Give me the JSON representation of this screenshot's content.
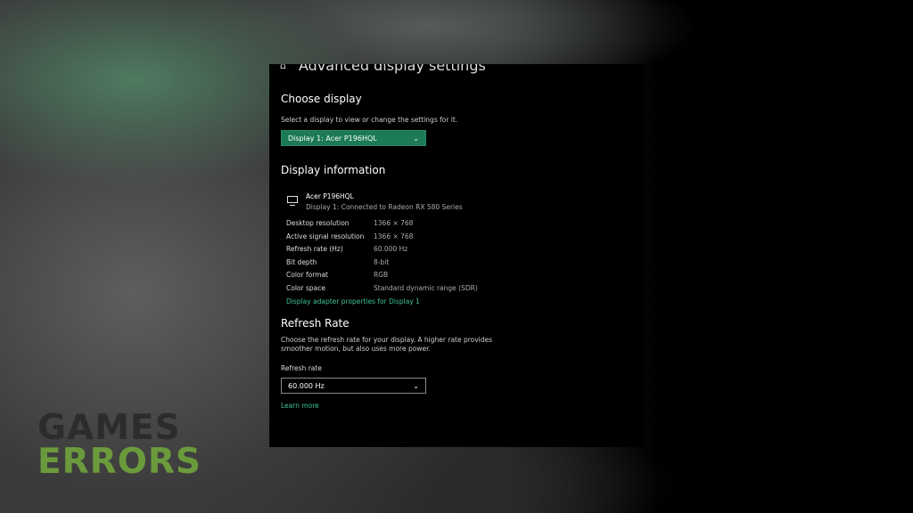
{
  "window": {
    "title": "Advanced display settings",
    "home_icon": "home-icon"
  },
  "choose_display": {
    "heading": "Choose display",
    "description": "Select a display to view or change the settings for it.",
    "selected": "Display 1: Acer P196HQL"
  },
  "display_info": {
    "heading": "Display information",
    "monitor_name": "Acer P196HQL",
    "connection": "Display 1: Connected to Radeon RX 580 Series",
    "rows": [
      {
        "label": "Desktop resolution",
        "value": "1366 × 768"
      },
      {
        "label": "Active signal resolution",
        "value": "1366 × 768"
      },
      {
        "label": "Refresh rate (Hz)",
        "value": "60.000 Hz"
      },
      {
        "label": "Bit depth",
        "value": "8-bit"
      },
      {
        "label": "Color format",
        "value": "RGB"
      },
      {
        "label": "Color space",
        "value": "Standard dynamic range (SDR)"
      }
    ],
    "adapter_link": "Display adapter properties for Display 1"
  },
  "refresh": {
    "heading": "Refresh Rate",
    "description_1": "Choose the refresh rate for your display. A higher rate provides",
    "description_2": "smoother motion, but also uses more power.",
    "label": "Refresh rate",
    "selected": "60.000 Hz",
    "learn_more": "Learn more"
  },
  "watermark": {
    "line1": "GAMES",
    "line2": "ERRORS"
  },
  "colors": {
    "accent": "#1c7a56",
    "link": "#3ec38e"
  }
}
